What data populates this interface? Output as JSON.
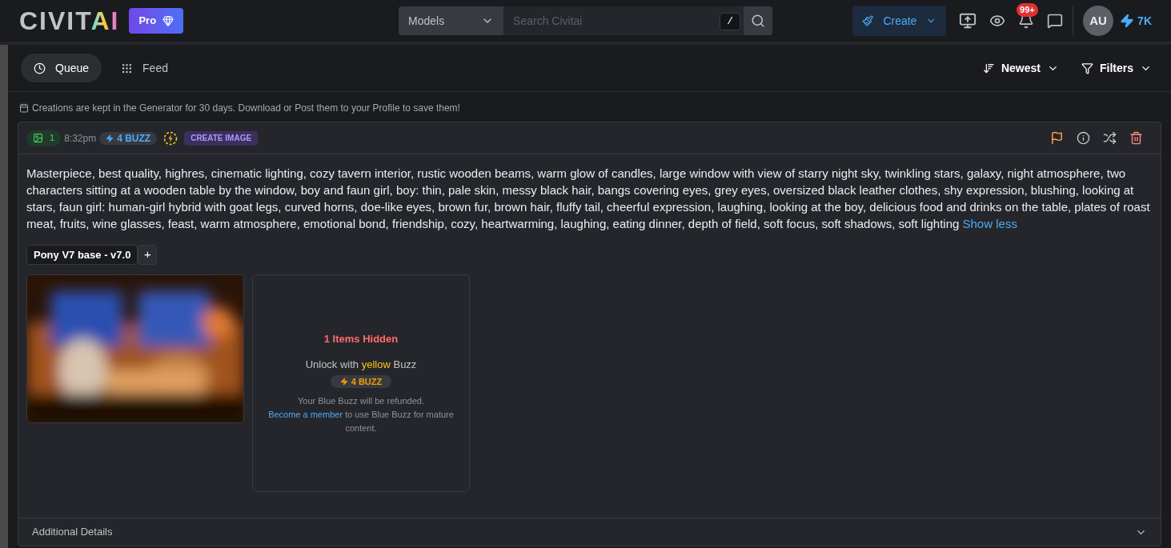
{
  "header": {
    "logo": {
      "part_1": "CIVIT",
      "part_2": "AI"
    },
    "pro_badge": "Pro",
    "search": {
      "scope": "Models",
      "placeholder": "Search Civitai",
      "shortcut": "/"
    },
    "create_button": "Create",
    "notifications_badge": "99+",
    "avatar": "AU",
    "buzz": "7K"
  },
  "tabs": [
    {
      "label": "Queue",
      "selected": true
    },
    {
      "label": "Feed",
      "selected": false
    }
  ],
  "sort": "Newest",
  "filters": "Filters",
  "notice": "Creations are kept in the Generator for 30 days. Download or Post them to your Profile to save them!",
  "job": {
    "image_count": "1",
    "time": "8:32pm",
    "cost": "4 BUZZ",
    "type_badge": "CREATE IMAGE",
    "prompt": "Masterpiece, best quality, highres, cinematic lighting, cozy tavern interior, rustic wooden beams, warm glow of candles, large window with view of starry night sky, twinkling stars, galaxy, night atmosphere, two characters sitting at a wooden table by the window, boy and faun girl, boy: thin, pale skin, messy black hair, bangs covering eyes, grey eyes, oversized black leather clothes, shy expression, blushing, looking at stars, faun girl: human-girl hybrid with goat legs, curved horns, doe-like eyes, brown fur, brown hair, fluffy tail, cheerful expression, laughing, looking at the boy, delicious food and drinks on the table, plates of roast meat, fruits, wine glasses, feast, warm atmosphere, emotional bond, friendship, cozy, heartwarming, laughing, eating dinner, depth of field, soft focus, soft shadows, soft lighting",
    "show_less": "Show less",
    "model_tag": "Pony V7 base - v7.0",
    "add_button": "+",
    "images": [
      {
        "kind": "picture"
      },
      {
        "kind": "hidden",
        "title": "1 Items Hidden",
        "unlock_before": "Unlock with",
        "unlock_highlight": "yellow",
        "unlock_after": "Buzz",
        "price": "4 BUZZ",
        "note": "Your Blue Buzz will be refunded.",
        "link": "Become a member",
        "note_after": "to use Blue Buzz for mature content."
      }
    ],
    "additional_details": "Additional Details"
  }
}
